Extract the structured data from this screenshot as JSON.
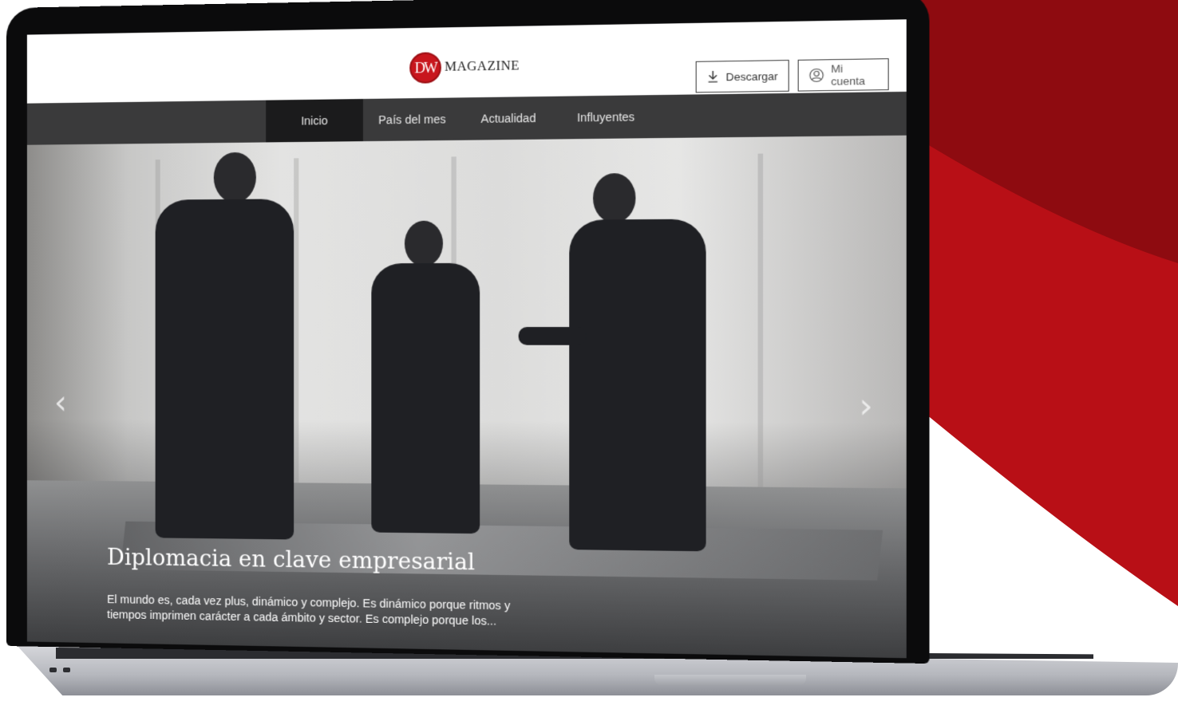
{
  "brand": {
    "logo_mark": "DW",
    "logo_text": "MAGAZINE",
    "accent_color": "#c8161d"
  },
  "header": {
    "download_label": "Descargar",
    "account_label": "Mi cuenta"
  },
  "nav": {
    "items": [
      {
        "label": "Inicio",
        "active": true
      },
      {
        "label": "País del mes",
        "active": false
      },
      {
        "label": "Actualidad",
        "active": false
      },
      {
        "label": "Influyentes",
        "active": false
      }
    ]
  },
  "hero": {
    "title": "Diplomacia en clave empresarial",
    "excerpt": "El mundo es, cada vez plus, dinámico y complejo. Es dinámico porque ritmos y tiempos imprimen carácter a cada ámbito y sector. Es complejo porque los...",
    "prev_icon": "chevron-left-icon",
    "next_icon": "chevron-right-icon",
    "prev_glyph": "‹",
    "next_glyph": "›"
  }
}
